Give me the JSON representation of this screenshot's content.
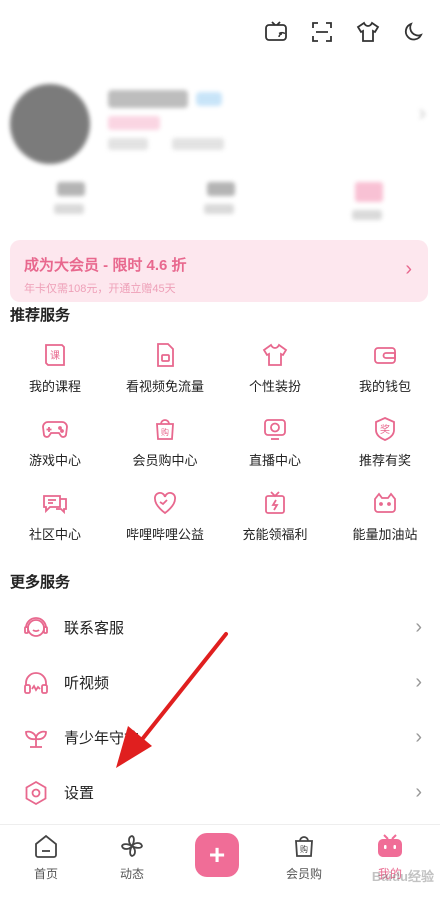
{
  "top_icons": [
    "tv-cast-icon",
    "scan-icon",
    "tshirt-icon",
    "night-mode-icon"
  ],
  "vip": {
    "title": "成为大会员 - 限时 4.6 折",
    "subtitle": "年卡仅需108元，开通立赠45天"
  },
  "recommended": {
    "title": "推荐服务",
    "items": [
      {
        "label": "我的课程",
        "icon": "course-book-icon"
      },
      {
        "label": "看视频免流量",
        "icon": "sim-card-icon"
      },
      {
        "label": "个性装扮",
        "icon": "outfit-icon"
      },
      {
        "label": "我的钱包",
        "icon": "wallet-icon"
      },
      {
        "label": "游戏中心",
        "icon": "gamepad-icon"
      },
      {
        "label": "会员购中心",
        "icon": "shopping-bag-icon"
      },
      {
        "label": "直播中心",
        "icon": "live-tv-icon"
      },
      {
        "label": "推荐有奖",
        "icon": "reward-badge-icon"
      },
      {
        "label": "社区中心",
        "icon": "chat-bubbles-icon"
      },
      {
        "label": "哔哩哔哩公益",
        "icon": "charity-heart-icon"
      },
      {
        "label": "充能领福利",
        "icon": "energy-gift-icon"
      },
      {
        "label": "能量加油站",
        "icon": "energy-station-icon"
      }
    ]
  },
  "more": {
    "title": "更多服务",
    "items": [
      {
        "label": "联系客服",
        "icon": "customer-service-icon"
      },
      {
        "label": "听视频",
        "icon": "headphones-icon"
      },
      {
        "label": "青少年守护",
        "icon": "youth-sprout-icon"
      },
      {
        "label": "设置",
        "icon": "settings-icon"
      }
    ]
  },
  "tabbar": {
    "home": "首页",
    "dynamic": "动态",
    "plus": "+",
    "mall": "会员购",
    "mine": "我的"
  },
  "colors": {
    "accent": "#f06d97",
    "pink_text": "#e8688e",
    "banner_bg": "#fde7ee",
    "annotation_arrow": "#e01f1f"
  },
  "watermark": "Baidu经验"
}
